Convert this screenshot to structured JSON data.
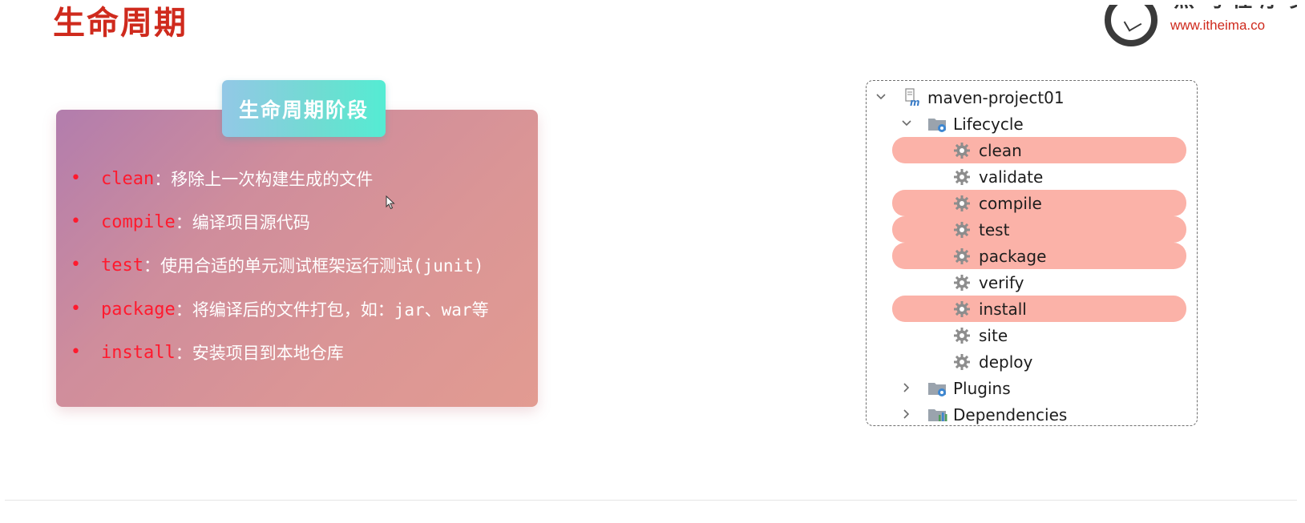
{
  "page_title": "生命周期",
  "logo": {
    "brand_text": "黑马程序员",
    "url_text": "www.itheima.co"
  },
  "card": {
    "tab_title": "生命周期阶段",
    "items": [
      {
        "keyword": "clean",
        "separator": "：",
        "description": "移除上一次构建生成的文件"
      },
      {
        "keyword": "compile",
        "separator": "：",
        "description": "编译项目源代码"
      },
      {
        "keyword": "test",
        "separator": "：",
        "description": "使用合适的单元测试框架运行测试(junit)"
      },
      {
        "keyword": "package",
        "separator": "：",
        "description": "将编译后的文件打包，如：jar、war等"
      },
      {
        "keyword": "install",
        "separator": "：",
        "description": "安装项目到本地仓库"
      }
    ],
    "bullet_glyph": "•"
  },
  "tree": {
    "root": {
      "label": "maven-project01",
      "icon": "maven-module-icon",
      "expanded": true
    },
    "lifecycle": {
      "label": "Lifecycle",
      "icon": "lifecycle-folder-icon",
      "expanded": true
    },
    "phases": [
      {
        "label": "clean",
        "highlighted": true
      },
      {
        "label": "validate",
        "highlighted": false
      },
      {
        "label": "compile",
        "highlighted": true
      },
      {
        "label": "test",
        "highlighted": true
      },
      {
        "label": "package",
        "highlighted": true
      },
      {
        "label": "verify",
        "highlighted": false
      },
      {
        "label": "install",
        "highlighted": true
      },
      {
        "label": "site",
        "highlighted": false
      },
      {
        "label": "deploy",
        "highlighted": false
      }
    ],
    "plugins": {
      "label": "Plugins",
      "icon": "plugins-folder-icon",
      "expanded": false
    },
    "dependencies": {
      "label": "Dependencies",
      "icon": "dependencies-folder-icon",
      "expanded": false
    }
  },
  "colors": {
    "title_red": "#cf2a1d",
    "keyword_red": "#ff1a2e",
    "highlight": "#fbb2a8",
    "tab_gradient": [
      "#93c8e6",
      "#54ecd3"
    ],
    "card_gradient": [
      "#b27dad",
      "#e29b91"
    ]
  }
}
